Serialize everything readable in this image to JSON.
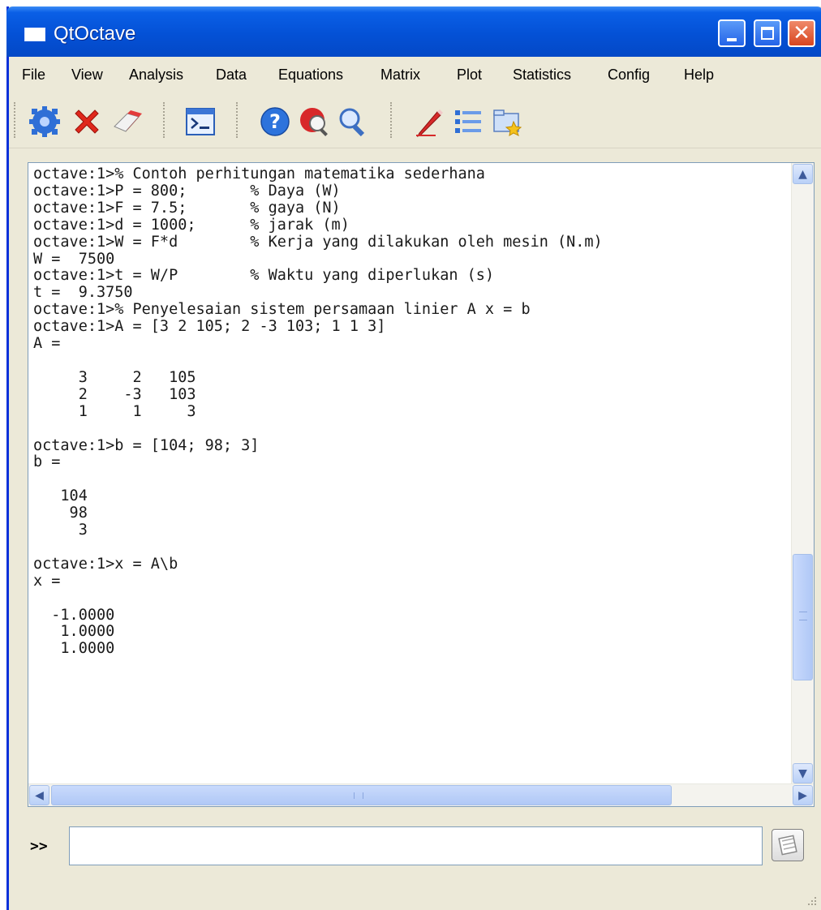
{
  "window": {
    "title": "QtOctave"
  },
  "menu": [
    "File",
    "View",
    "Analysis",
    "Data",
    "Equations",
    "Matrix",
    "Plot",
    "Statistics",
    "Config",
    "Help"
  ],
  "toolbar": {
    "icons": [
      "gear-icon",
      "delete-icon",
      "eraser-icon",
      "terminal-window-icon",
      "help-icon",
      "search-help-icon",
      "zoom-icon",
      "edit-pencil-icon",
      "list-icon",
      "open-folder-icon"
    ]
  },
  "console": {
    "lines": [
      "octave:1>% Contoh perhitungan matematika sederhana",
      "octave:1>P = 800;       % Daya (W)",
      "octave:1>F = 7.5;       % gaya (N)",
      "octave:1>d = 1000;      % jarak (m)",
      "octave:1>W = F*d        % Kerja yang dilakukan oleh mesin (N.m)",
      "W =  7500",
      "octave:1>t = W/P        % Waktu yang diperlukan (s)",
      "t =  9.3750",
      "octave:1>% Penyelesaian sistem persamaan linier A x = b",
      "octave:1>A = [3 2 105; 2 -3 103; 1 1 3]",
      "A =",
      "",
      "     3     2   105",
      "     2    -3   103",
      "     1     1     3",
      "",
      "octave:1>b = [104; 98; 3]",
      "b =",
      "",
      "   104",
      "    98",
      "     3",
      "",
      "octave:1>x = A\\b",
      "x =",
      "",
      "  -1.0000",
      "   1.0000",
      "   1.0000"
    ]
  },
  "command": {
    "prompt": ">>",
    "value": ""
  },
  "colors": {
    "titlebar": "#0451d6",
    "face": "#ece9d8",
    "scroll_accent": "#b9d0f7"
  }
}
